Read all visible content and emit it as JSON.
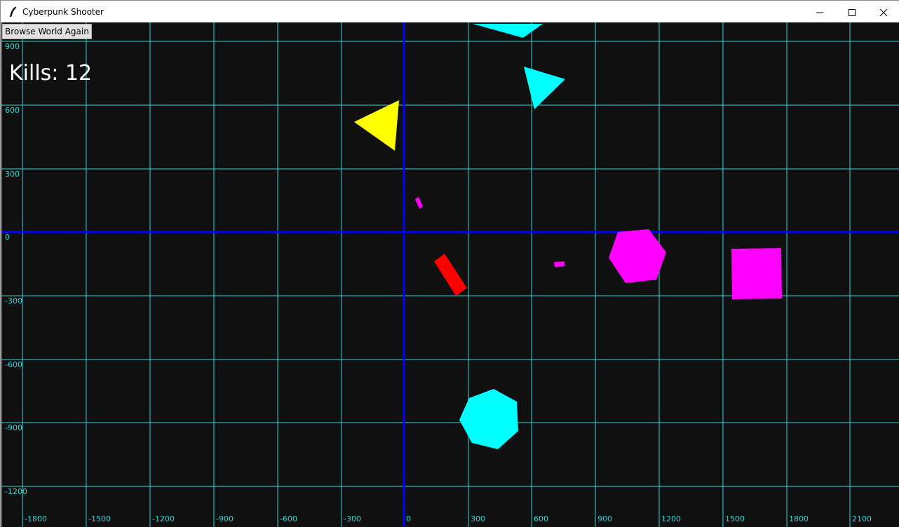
{
  "window": {
    "title": "Cyberpunk Shooter",
    "icons": {
      "app": "feather-icon",
      "minimize": "minimize-icon",
      "maximize": "maximize-icon",
      "close": "close-icon"
    }
  },
  "toolbar": {
    "browse_label": "Browse World Again"
  },
  "hud": {
    "kills_label": "Kills: 12"
  },
  "grid": {
    "color": "#2fd6d6",
    "axis_color": "#0000ff",
    "background": "#101010",
    "x_ticks": [
      "-1800",
      "-1500",
      "-1200",
      "-900",
      "-600",
      "-300",
      "0",
      "300",
      "600",
      "900",
      "1200",
      "1500",
      "1800",
      "2100"
    ],
    "y_ticks": [
      "900",
      "600",
      "300",
      "0",
      "-300",
      "-600",
      "-900",
      "-1200"
    ]
  },
  "entities": [
    {
      "kind": "triangle",
      "color": "#00ffff"
    },
    {
      "kind": "triangle",
      "color": "#00ffff"
    },
    {
      "kind": "triangle",
      "color": "#ffff00"
    },
    {
      "kind": "bullet",
      "color": "#ff00ff"
    },
    {
      "kind": "player",
      "color": "#ff0000"
    },
    {
      "kind": "bullet",
      "color": "#ff00ff"
    },
    {
      "kind": "hexagon",
      "color": "#ff00ff"
    },
    {
      "kind": "square",
      "color": "#ff00ff"
    },
    {
      "kind": "heptagon",
      "color": "#00ffff"
    }
  ]
}
